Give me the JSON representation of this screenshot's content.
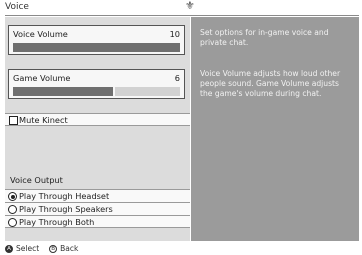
{
  "header": {
    "title": "Voice"
  },
  "voice_volume": {
    "label": "Voice Volume",
    "value": "10",
    "level": 1.0
  },
  "game_volume": {
    "label": "Game Volume",
    "value": "6",
    "level": 0.6
  },
  "mute_kinect": {
    "label": "Mute Kinect",
    "checked": false
  },
  "voice_output": {
    "label": "Voice Output",
    "options": [
      {
        "label": "Play Through Headset",
        "selected": true
      },
      {
        "label": "Play Through Speakers",
        "selected": false
      },
      {
        "label": "Play Through Both",
        "selected": false
      }
    ]
  },
  "description": {
    "p1": "Set options for in-game voice and private chat.",
    "p2": "Voice Volume adjusts how loud other people sound. Game Volume adjusts the game's volume during chat."
  },
  "footer": {
    "select_label": "Select",
    "back_label": "Back",
    "select_glyph": "A",
    "back_glyph": "B"
  }
}
